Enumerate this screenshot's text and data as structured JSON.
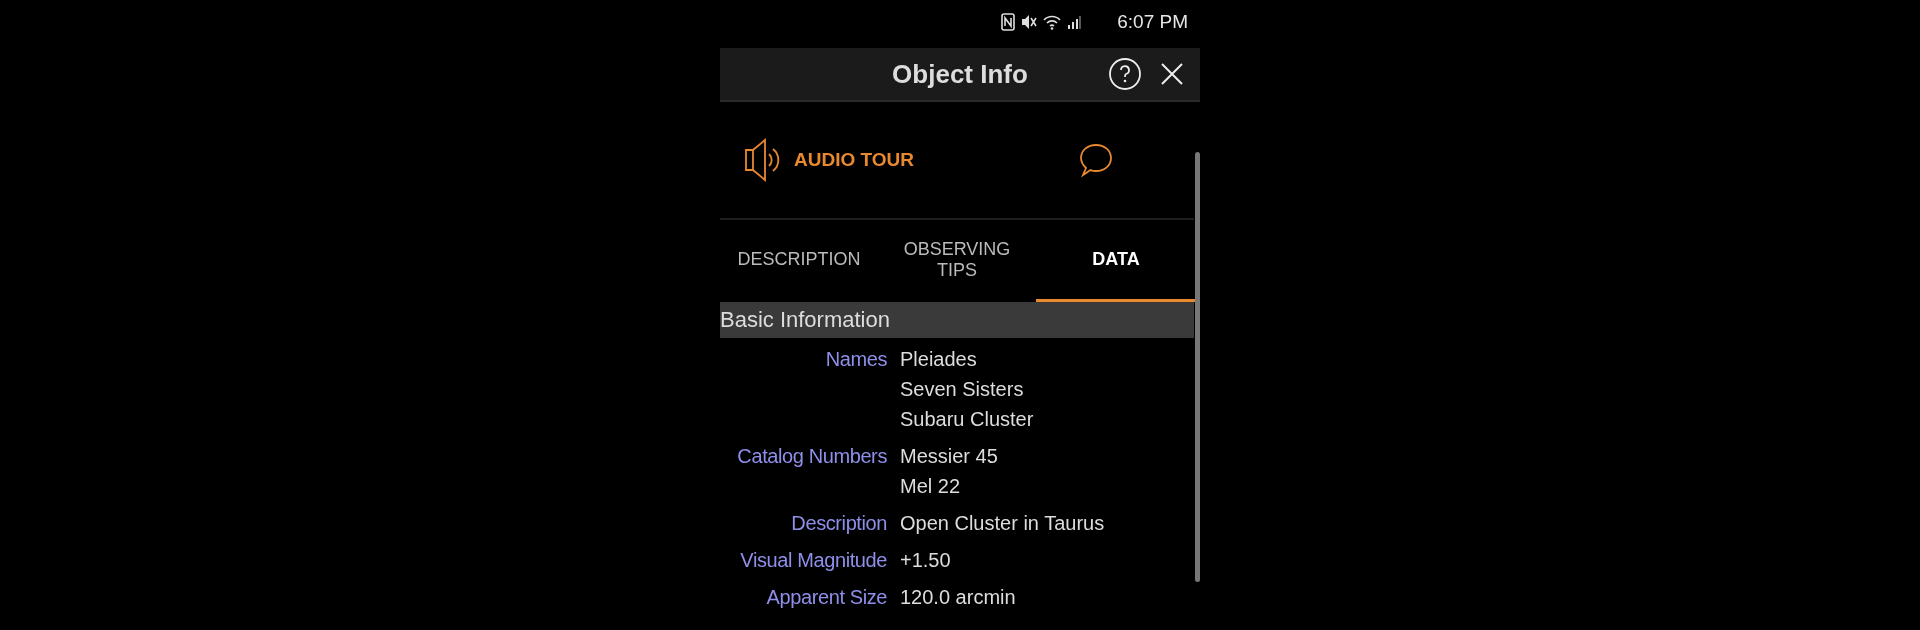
{
  "status_bar": {
    "time": "6:07 PM"
  },
  "header": {
    "title": "Object Info"
  },
  "audio_tour": {
    "label": "AUDIO TOUR"
  },
  "tabs": [
    {
      "label": "DESCRIPTION",
      "selected": false
    },
    {
      "label": "OBSERVING TIPS",
      "selected": false
    },
    {
      "label": "DATA",
      "selected": true
    }
  ],
  "section": {
    "title": "Basic Information"
  },
  "rows": [
    {
      "label": "Names",
      "values": [
        "Pleiades",
        "Seven Sisters",
        "Subaru Cluster"
      ]
    },
    {
      "label": "Catalog Numbers",
      "values": [
        "Messier 45",
        "Mel 22"
      ]
    },
    {
      "label": "Description",
      "values": [
        "Open Cluster in Taurus"
      ]
    },
    {
      "label": "Visual Magnitude",
      "values": [
        "+1.50"
      ]
    },
    {
      "label": "Apparent Size",
      "values": [
        "120.0 arcmin"
      ]
    }
  ]
}
